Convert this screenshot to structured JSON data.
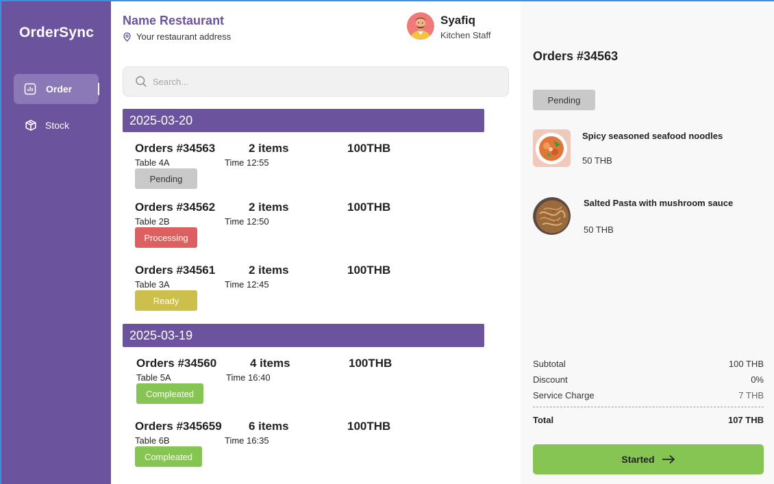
{
  "app": {
    "brand": "OrderSync"
  },
  "colors": {
    "primary": "#6b549d",
    "pending": "#c9c9c9",
    "processing": "#dd6060",
    "ready": "#cdbf4c",
    "complete": "#86c454"
  },
  "sidebar": {
    "items": [
      {
        "label": "Order",
        "icon": "chart-icon",
        "active": true
      },
      {
        "label": "Stock",
        "icon": "box-icon",
        "active": false
      }
    ]
  },
  "header": {
    "restaurant_name": "Name Restaurant",
    "restaurant_address": "Your restaurant address",
    "user_name": "Syafiq",
    "user_role": "Kitchen Staff"
  },
  "search": {
    "placeholder": "Search...",
    "value": ""
  },
  "groups": [
    {
      "date": "2025-03-20",
      "orders": [
        {
          "id": "Orders #34563",
          "items": "2 items",
          "price": "100THB",
          "table": "Table 4A",
          "time": "Time 12:55",
          "status": "Pending"
        },
        {
          "id": "Orders #34562",
          "items": "2 items",
          "price": "100THB",
          "table": "Table 2B",
          "time": "Time 12:50",
          "status": "Processing"
        },
        {
          "id": "Orders #34561",
          "items": "2 items",
          "price": "100THB",
          "table": "Table 3A",
          "time": "Time 12:45",
          "status": "Ready"
        }
      ]
    },
    {
      "date": "2025-03-19",
      "orders": [
        {
          "id": "Orders #34560",
          "items": "4 items",
          "price": "100THB",
          "table": "Table 5A",
          "time": "Time 16:40",
          "status": "Compleated"
        },
        {
          "id": "Orders #345659",
          "items": "6 items",
          "price": "100THB",
          "table": "Table 6B",
          "time": "Time 16:35",
          "status": "Compleated"
        }
      ]
    }
  ],
  "detail": {
    "title": "Orders #34563",
    "status": "Pending",
    "items": [
      {
        "name": "Spicy seasoned seafood noodles",
        "price": "50 THB"
      },
      {
        "name": "Salted Pasta with mushroom sauce",
        "price": "50 THB"
      }
    ],
    "summary": {
      "subtotal_label": "Subtotal",
      "subtotal": "100 THB",
      "discount_label": "Discount",
      "discount": "0%",
      "service_label": "Service Charge",
      "service": "7 THB",
      "total_label": "Total",
      "total": "107 THB"
    },
    "action_label": "Started"
  }
}
